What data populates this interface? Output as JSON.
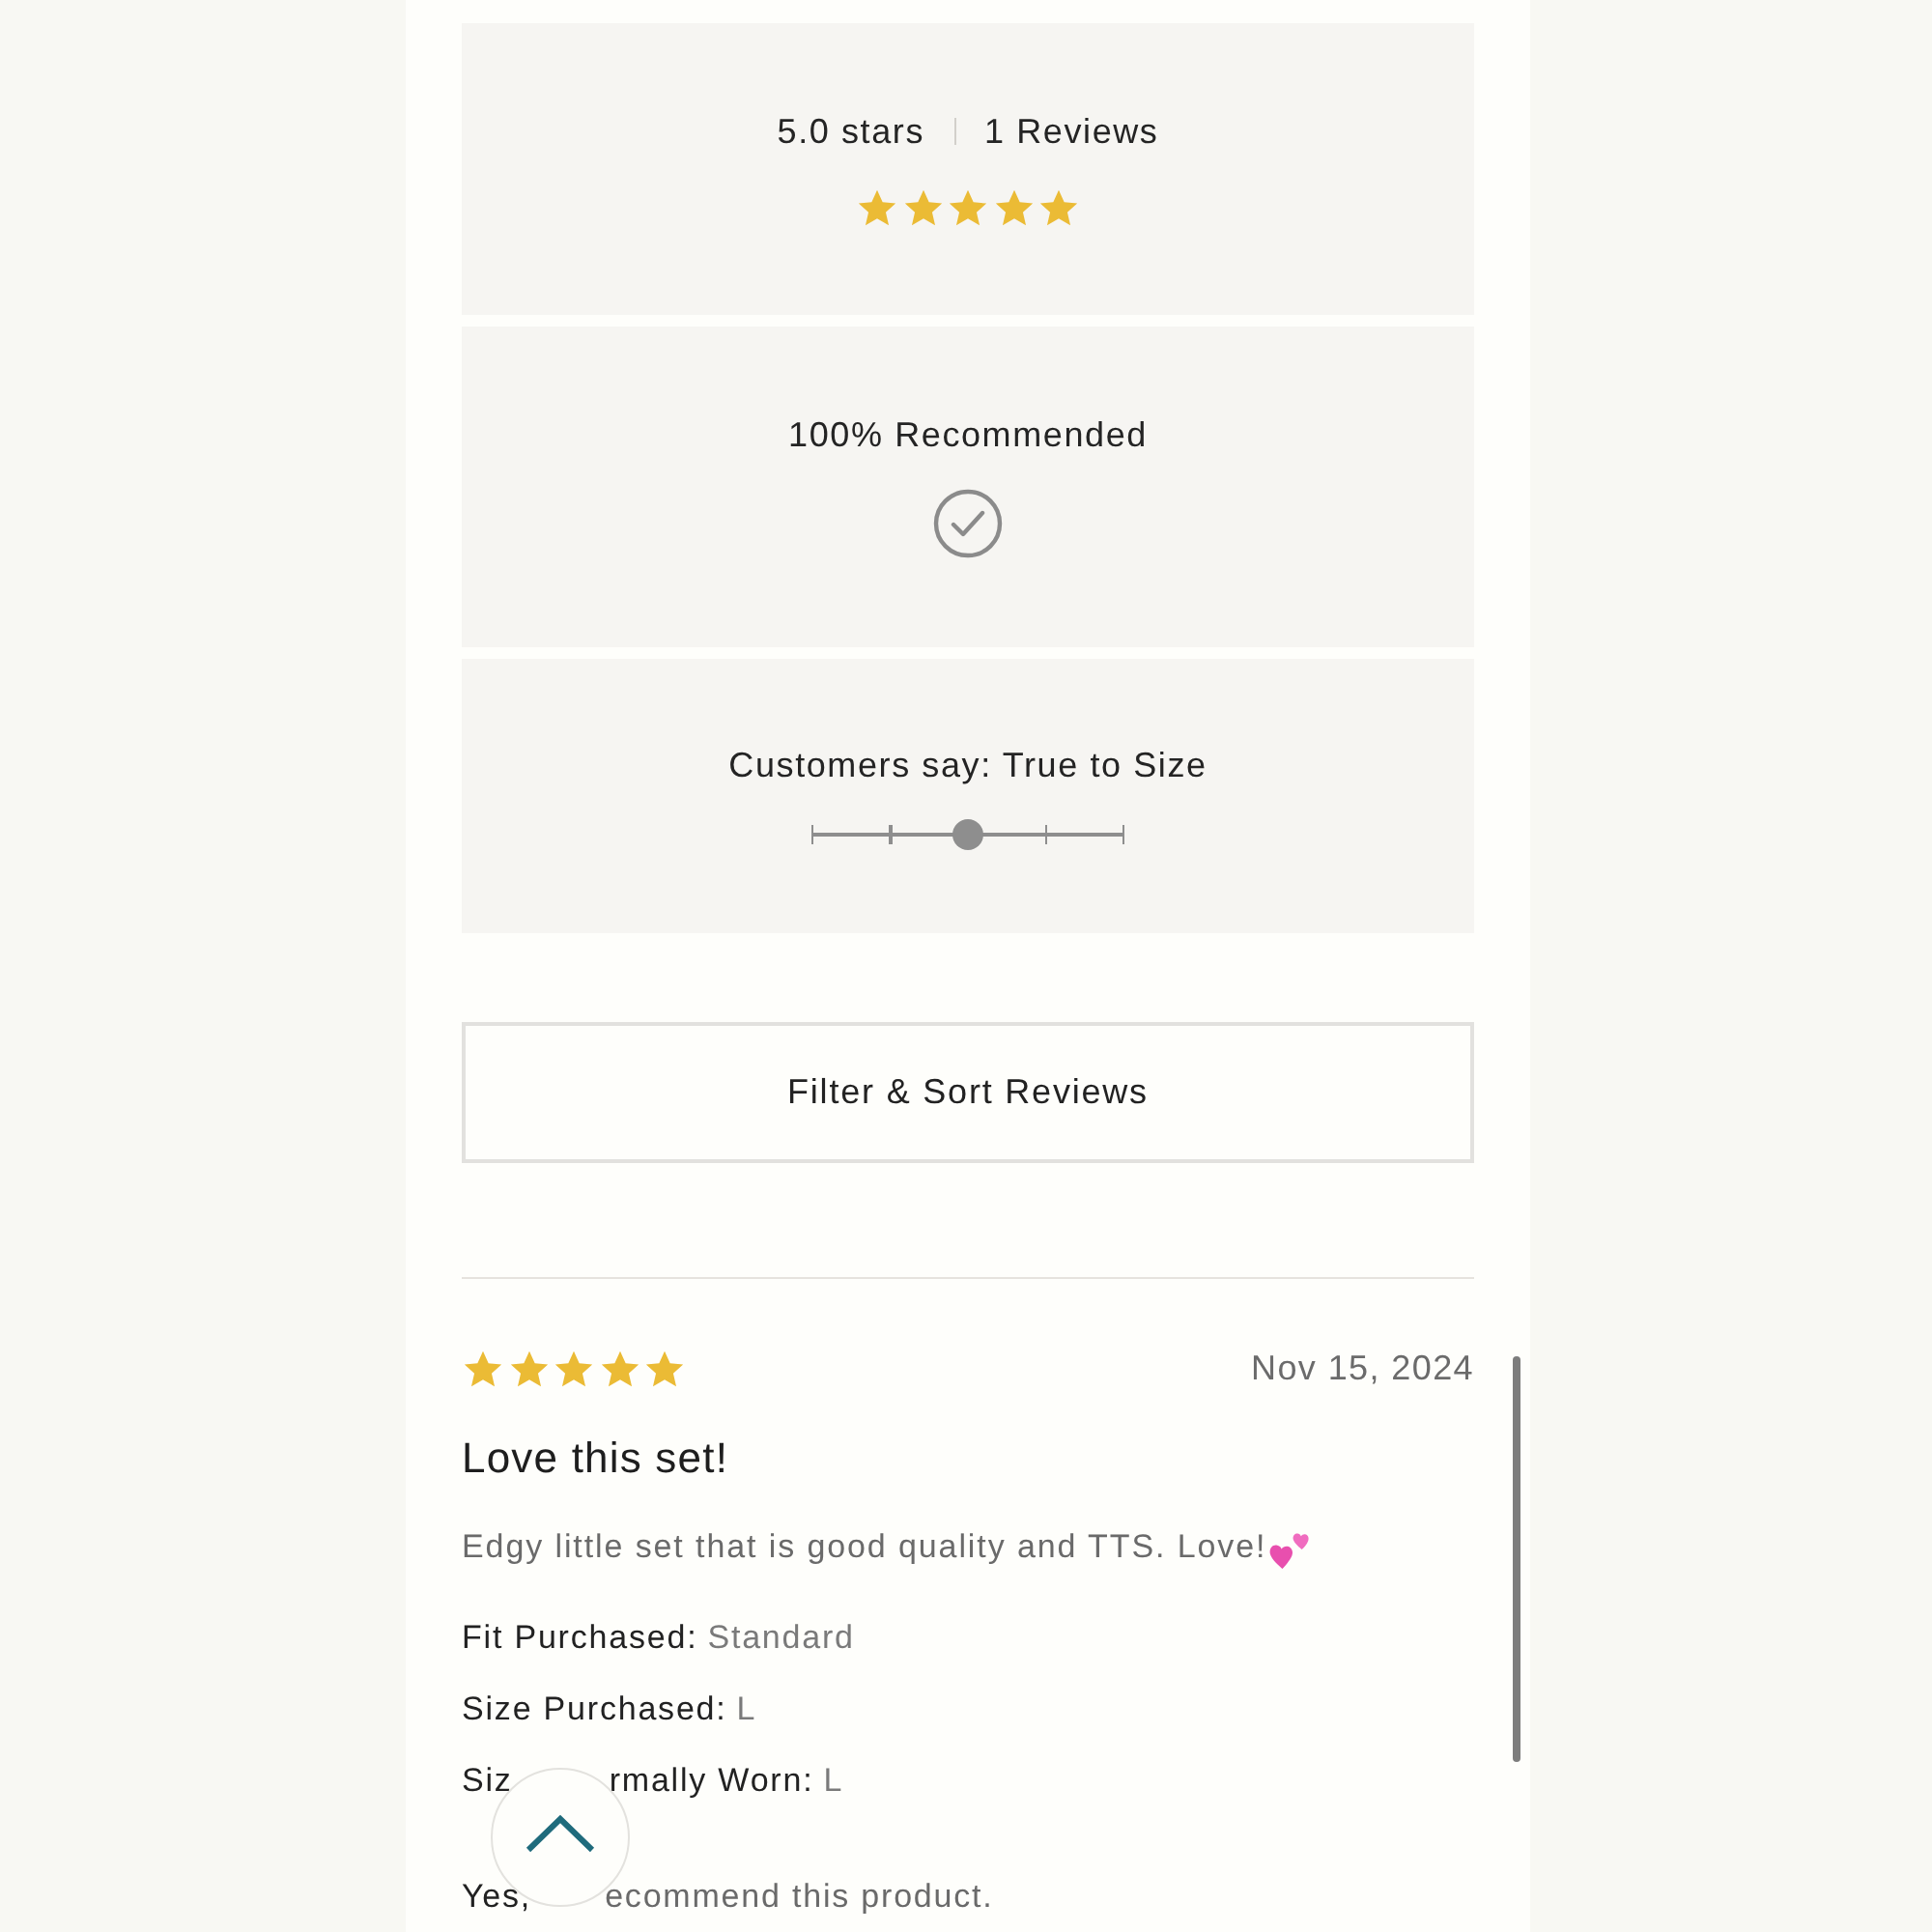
{
  "summary": {
    "rating": "5.0 stars",
    "reviews": "1 Reviews",
    "stars": 5
  },
  "recommendation": {
    "label": "100% Recommended"
  },
  "fit": {
    "label": "Customers say: True to Size",
    "level": 0.5
  },
  "filter_button": {
    "label": "Filter & Sort Reviews"
  },
  "review": {
    "stars": 5,
    "date": "Nov 15, 2024",
    "title": "Love this set!",
    "body": "Edgy little set that is good quality and TTS. Love!",
    "details": [
      {
        "label": "Fit Purchased:",
        "value": "Standard"
      },
      {
        "label": "Size Purchased:",
        "value": "L"
      },
      {
        "label": "Siz",
        "label_after_cover": "rmally Worn:",
        "value": "L"
      }
    ],
    "recommend": {
      "answer": "Yes,",
      "text_after_cover": "ecommend this product."
    }
  }
}
